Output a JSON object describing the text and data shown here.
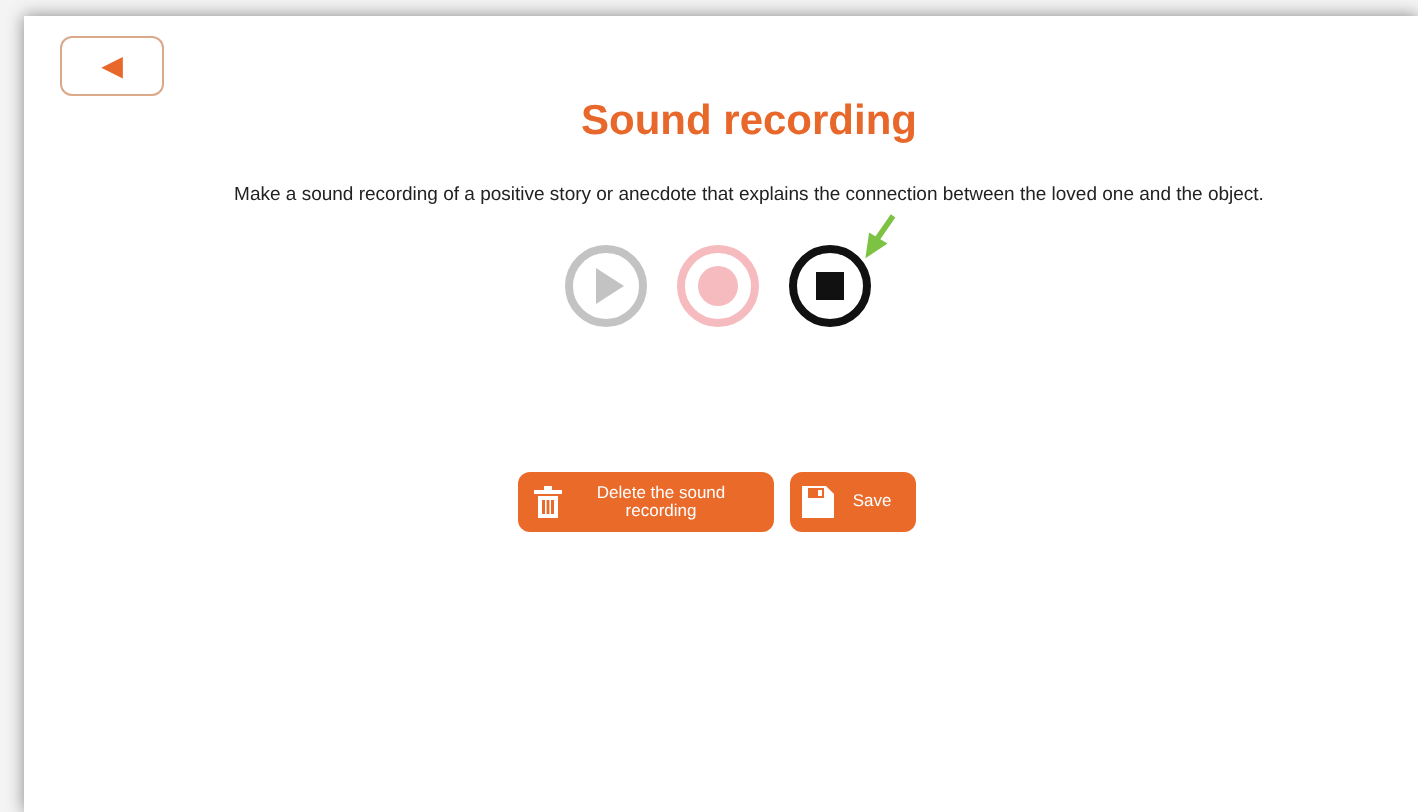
{
  "back_button": {
    "label": "◄"
  },
  "title": "Sound recording",
  "instruction": "Make a sound recording of a positive story or anecdote that explains the connection between the loved one and the object.",
  "controls": [
    {
      "kind": "play",
      "disabled": true
    },
    {
      "kind": "record",
      "disabled": true
    },
    {
      "kind": "stop",
      "disabled": false
    }
  ],
  "buttons": [
    {
      "kind": "delete",
      "label": "Delete the sound recording"
    },
    {
      "kind": "save",
      "label": "Save"
    }
  ]
}
